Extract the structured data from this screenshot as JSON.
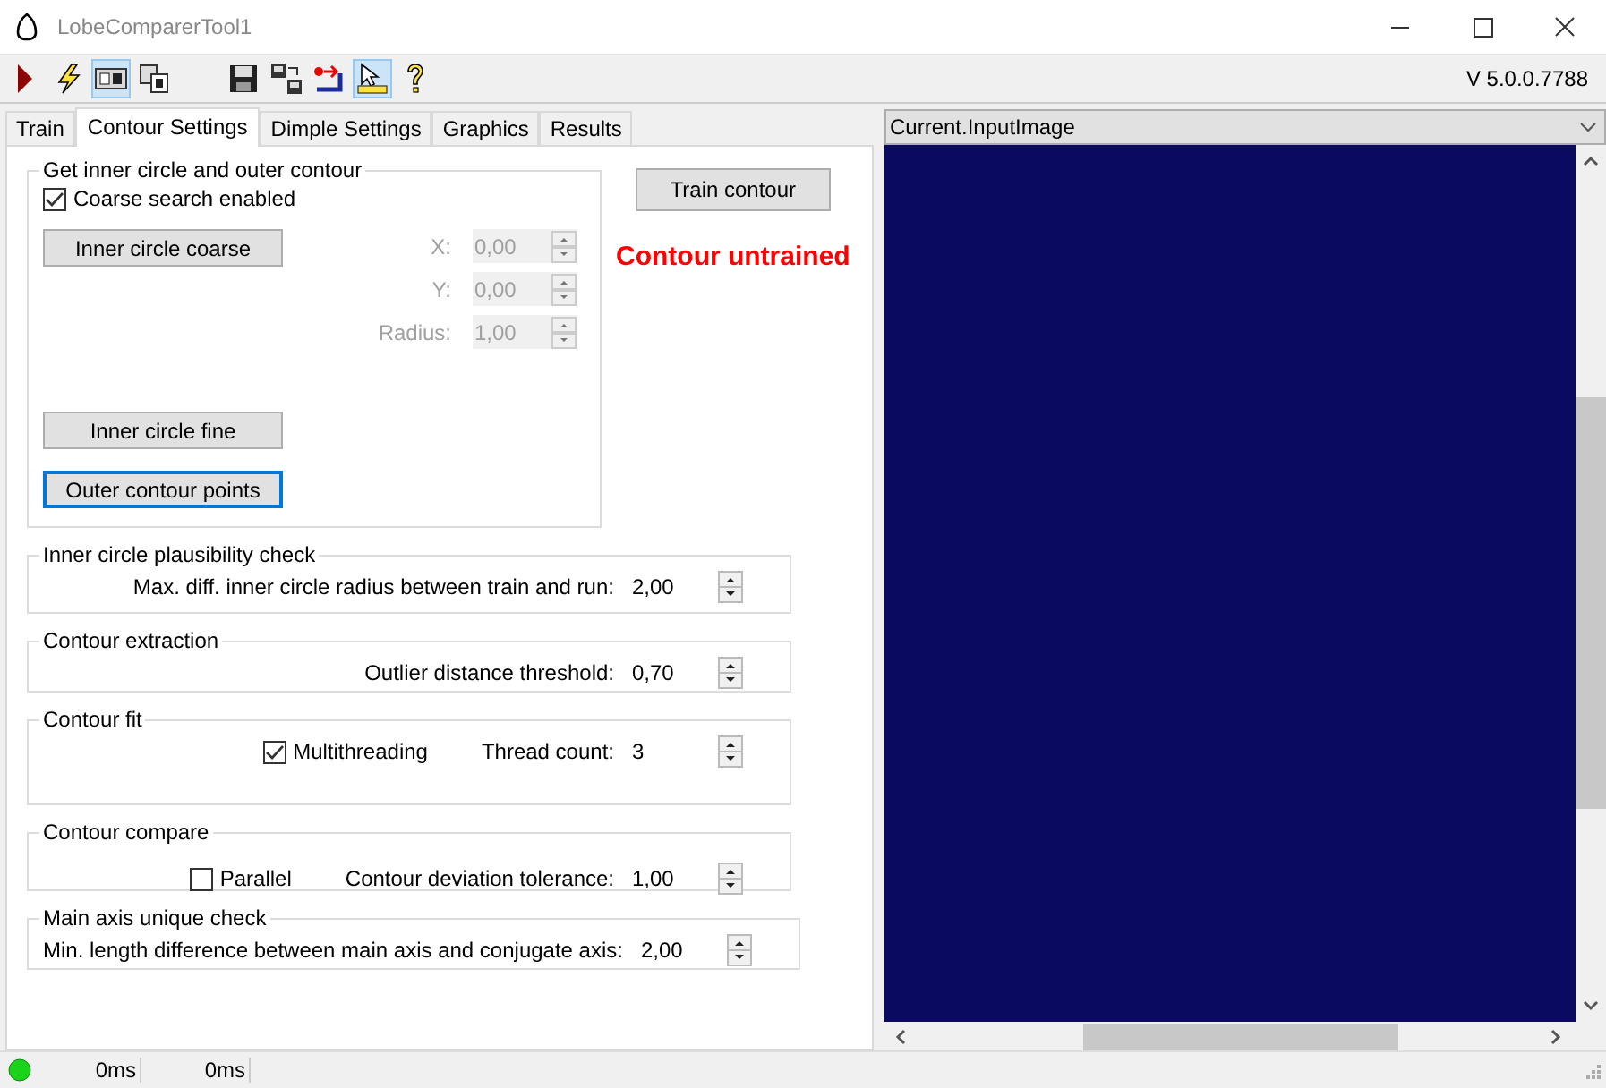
{
  "window": {
    "title": "LobeComparerTool1"
  },
  "toolbar": {
    "groups": [
      [
        {
          "kind": "play",
          "pressed": false
        },
        {
          "kind": "lightning",
          "pressed": false
        },
        {
          "kind": "card",
          "pressed": true
        },
        {
          "kind": "cards",
          "pressed": false
        }
      ],
      [
        {
          "kind": "save",
          "pressed": false
        },
        {
          "kind": "transfer",
          "pressed": false
        },
        {
          "kind": "return",
          "pressed": false
        },
        {
          "kind": "pointer",
          "pressed": true
        },
        {
          "kind": "help",
          "pressed": false
        }
      ]
    ],
    "version": "V 5.0.0.7788"
  },
  "tabs": [
    {
      "label": "Train",
      "selected": false
    },
    {
      "label": "Contour Settings",
      "selected": true
    },
    {
      "label": "Dimple Settings",
      "selected": false
    },
    {
      "label": "Graphics",
      "selected": false
    },
    {
      "label": "Results",
      "selected": false
    }
  ],
  "contour_group": {
    "title": "Get inner circle and outer contour",
    "coarse_search": {
      "label": "Coarse search enabled",
      "checked": true
    },
    "coarse_button": {
      "label": "Inner circle coarse",
      "focused": false
    },
    "spinners": [
      {
        "label": "X:",
        "value": "0,00",
        "disabled": true
      },
      {
        "label": "Y:",
        "value": "0,00",
        "disabled": true
      },
      {
        "label": "Radius:",
        "value": "1,00",
        "disabled": true
      }
    ],
    "buttons": [
      {
        "label": "Inner circle fine",
        "focused": false
      },
      {
        "label": "Outer contour points",
        "focused": true
      }
    ]
  },
  "train_button": {
    "label": "Train contour"
  },
  "train_status": "Contour untrained",
  "groups": [
    {
      "title": "Inner circle plausibility check",
      "field": {
        "label": "Max. diff. inner circle radius between train and run:",
        "value": "2,00"
      }
    },
    {
      "title": "Contour extraction",
      "field": {
        "label": "Outlier distance threshold:",
        "value": "0,70"
      }
    },
    {
      "title": "Contour fit",
      "checkbox": {
        "label": "Multithreading",
        "checked": true
      },
      "field": {
        "label": "Thread count:",
        "value": "3"
      }
    },
    {
      "title": "Contour compare",
      "checkbox": {
        "label": "Parallel",
        "checked": false
      },
      "field": {
        "label": "Contour deviation tolerance:",
        "value": "1,00"
      }
    },
    {
      "title": "Main axis unique check",
      "field": {
        "label": "Min. length difference between main axis and conjugate axis:",
        "value": "2,00"
      }
    }
  ],
  "image_view": {
    "source": "Current.InputImage"
  },
  "status_bar": {
    "ok": true,
    "times": [
      "0ms",
      "0ms"
    ]
  }
}
